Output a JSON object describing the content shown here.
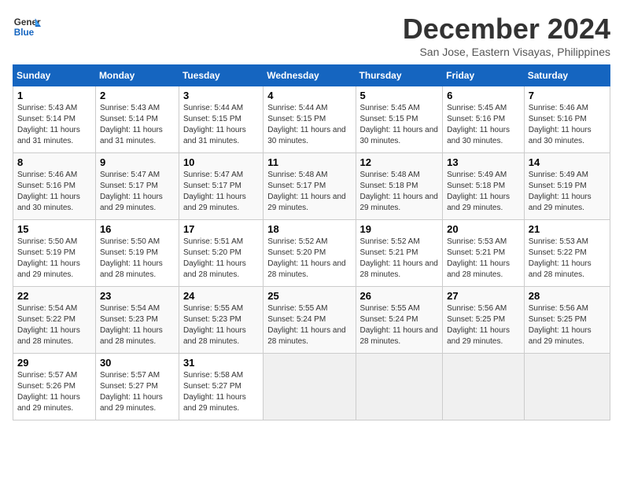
{
  "header": {
    "logo_line1": "General",
    "logo_line2": "Blue",
    "month": "December 2024",
    "location": "San Jose, Eastern Visayas, Philippines"
  },
  "weekdays": [
    "Sunday",
    "Monday",
    "Tuesday",
    "Wednesday",
    "Thursday",
    "Friday",
    "Saturday"
  ],
  "weeks": [
    [
      {
        "day": "1",
        "text": "Sunrise: 5:43 AM\nSunset: 5:14 PM\nDaylight: 11 hours and 31 minutes."
      },
      {
        "day": "2",
        "text": "Sunrise: 5:43 AM\nSunset: 5:14 PM\nDaylight: 11 hours and 31 minutes."
      },
      {
        "day": "3",
        "text": "Sunrise: 5:44 AM\nSunset: 5:15 PM\nDaylight: 11 hours and 31 minutes."
      },
      {
        "day": "4",
        "text": "Sunrise: 5:44 AM\nSunset: 5:15 PM\nDaylight: 11 hours and 30 minutes."
      },
      {
        "day": "5",
        "text": "Sunrise: 5:45 AM\nSunset: 5:15 PM\nDaylight: 11 hours and 30 minutes."
      },
      {
        "day": "6",
        "text": "Sunrise: 5:45 AM\nSunset: 5:16 PM\nDaylight: 11 hours and 30 minutes."
      },
      {
        "day": "7",
        "text": "Sunrise: 5:46 AM\nSunset: 5:16 PM\nDaylight: 11 hours and 30 minutes."
      }
    ],
    [
      {
        "day": "8",
        "text": "Sunrise: 5:46 AM\nSunset: 5:16 PM\nDaylight: 11 hours and 30 minutes."
      },
      {
        "day": "9",
        "text": "Sunrise: 5:47 AM\nSunset: 5:17 PM\nDaylight: 11 hours and 29 minutes."
      },
      {
        "day": "10",
        "text": "Sunrise: 5:47 AM\nSunset: 5:17 PM\nDaylight: 11 hours and 29 minutes."
      },
      {
        "day": "11",
        "text": "Sunrise: 5:48 AM\nSunset: 5:17 PM\nDaylight: 11 hours and 29 minutes."
      },
      {
        "day": "12",
        "text": "Sunrise: 5:48 AM\nSunset: 5:18 PM\nDaylight: 11 hours and 29 minutes."
      },
      {
        "day": "13",
        "text": "Sunrise: 5:49 AM\nSunset: 5:18 PM\nDaylight: 11 hours and 29 minutes."
      },
      {
        "day": "14",
        "text": "Sunrise: 5:49 AM\nSunset: 5:19 PM\nDaylight: 11 hours and 29 minutes."
      }
    ],
    [
      {
        "day": "15",
        "text": "Sunrise: 5:50 AM\nSunset: 5:19 PM\nDaylight: 11 hours and 29 minutes."
      },
      {
        "day": "16",
        "text": "Sunrise: 5:50 AM\nSunset: 5:19 PM\nDaylight: 11 hours and 28 minutes."
      },
      {
        "day": "17",
        "text": "Sunrise: 5:51 AM\nSunset: 5:20 PM\nDaylight: 11 hours and 28 minutes."
      },
      {
        "day": "18",
        "text": "Sunrise: 5:52 AM\nSunset: 5:20 PM\nDaylight: 11 hours and 28 minutes."
      },
      {
        "day": "19",
        "text": "Sunrise: 5:52 AM\nSunset: 5:21 PM\nDaylight: 11 hours and 28 minutes."
      },
      {
        "day": "20",
        "text": "Sunrise: 5:53 AM\nSunset: 5:21 PM\nDaylight: 11 hours and 28 minutes."
      },
      {
        "day": "21",
        "text": "Sunrise: 5:53 AM\nSunset: 5:22 PM\nDaylight: 11 hours and 28 minutes."
      }
    ],
    [
      {
        "day": "22",
        "text": "Sunrise: 5:54 AM\nSunset: 5:22 PM\nDaylight: 11 hours and 28 minutes."
      },
      {
        "day": "23",
        "text": "Sunrise: 5:54 AM\nSunset: 5:23 PM\nDaylight: 11 hours and 28 minutes."
      },
      {
        "day": "24",
        "text": "Sunrise: 5:55 AM\nSunset: 5:23 PM\nDaylight: 11 hours and 28 minutes."
      },
      {
        "day": "25",
        "text": "Sunrise: 5:55 AM\nSunset: 5:24 PM\nDaylight: 11 hours and 28 minutes."
      },
      {
        "day": "26",
        "text": "Sunrise: 5:55 AM\nSunset: 5:24 PM\nDaylight: 11 hours and 28 minutes."
      },
      {
        "day": "27",
        "text": "Sunrise: 5:56 AM\nSunset: 5:25 PM\nDaylight: 11 hours and 29 minutes."
      },
      {
        "day": "28",
        "text": "Sunrise: 5:56 AM\nSunset: 5:25 PM\nDaylight: 11 hours and 29 minutes."
      }
    ],
    [
      {
        "day": "29",
        "text": "Sunrise: 5:57 AM\nSunset: 5:26 PM\nDaylight: 11 hours and 29 minutes."
      },
      {
        "day": "30",
        "text": "Sunrise: 5:57 AM\nSunset: 5:27 PM\nDaylight: 11 hours and 29 minutes."
      },
      {
        "day": "31",
        "text": "Sunrise: 5:58 AM\nSunset: 5:27 PM\nDaylight: 11 hours and 29 minutes."
      },
      null,
      null,
      null,
      null
    ]
  ]
}
